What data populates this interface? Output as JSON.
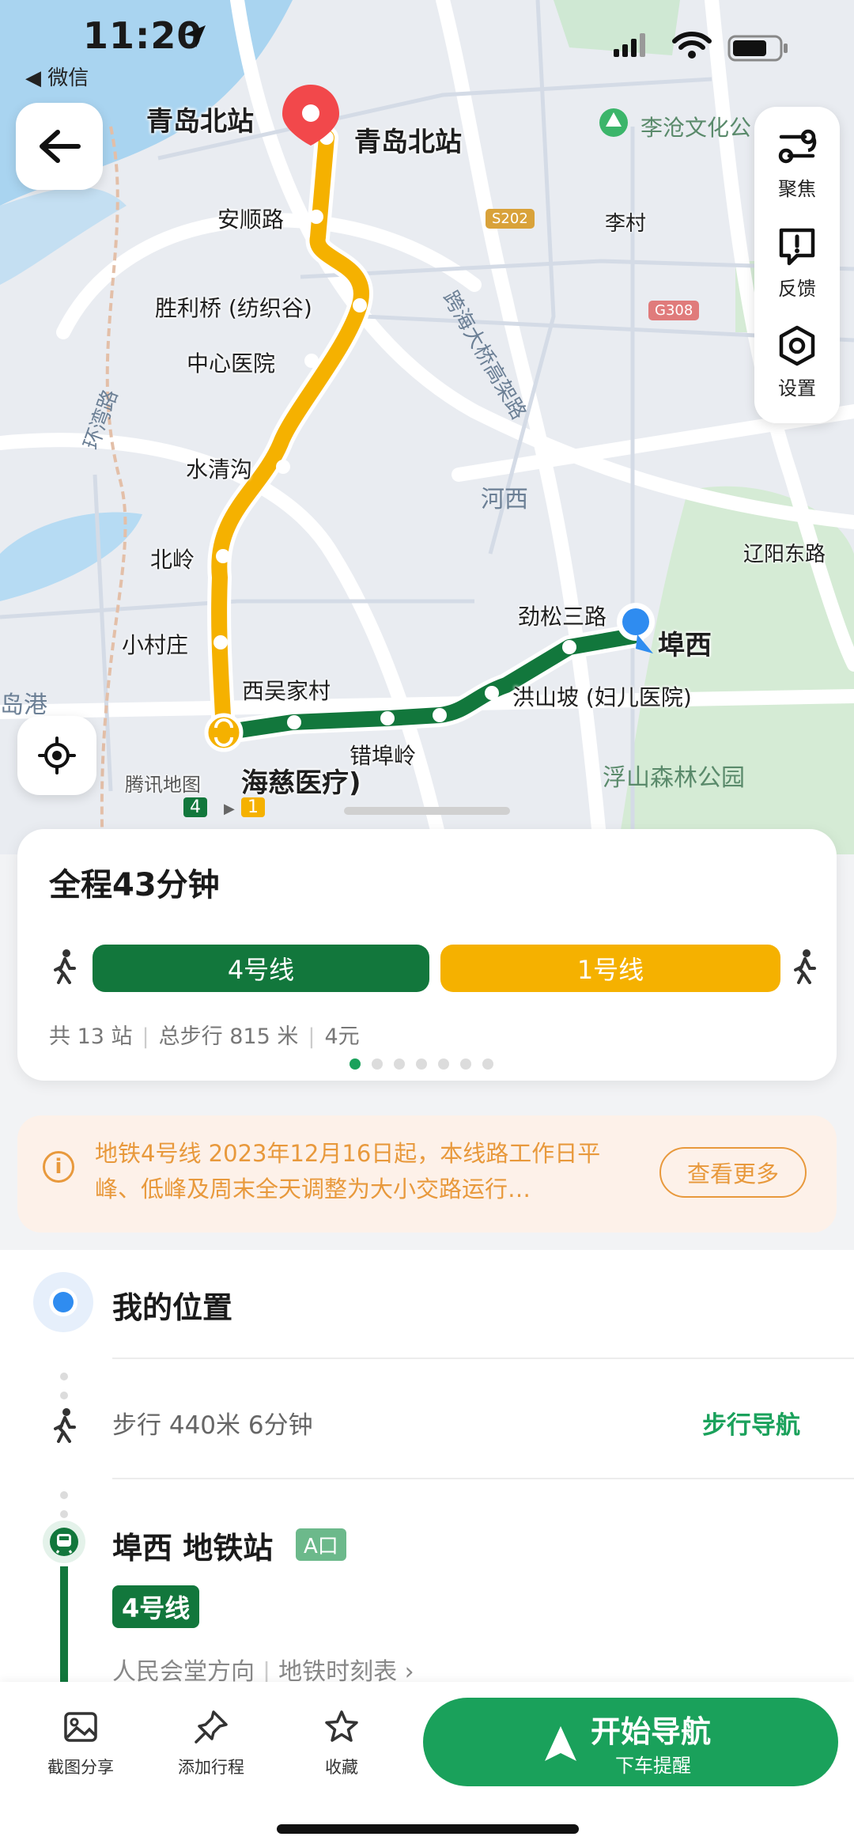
{
  "status_bar": {
    "time": "11:20",
    "back_app": "◀ 微信"
  },
  "map": {
    "tools": [
      {
        "label": "聚焦",
        "icon": "focus-icon"
      },
      {
        "label": "反馈",
        "icon": "feedback-icon"
      },
      {
        "label": "设置",
        "icon": "settings-icon"
      }
    ],
    "destination_label": "青岛北站",
    "station_labels": {
      "qingdao_north": "青岛北站",
      "anshun": "安顺路",
      "shengliqiao": "胜利桥 (纺织谷)",
      "zhongxin": "中心医院",
      "shuiqinggou": "水清沟",
      "beiling": "北岭",
      "xiaocunzhuang": "小村庄",
      "xiwujiacun": "西吴家村",
      "cuofuling": "错埠岭",
      "hongshanpo": "洪山坡 (妇儿医院)",
      "jinsong": "劲松三路",
      "fuxi": "埠西",
      "haici": "海慈医疗)"
    },
    "area_labels": {
      "licun": "李村",
      "hexi": "河西",
      "liaoyang": "辽阳东路",
      "park": "浮山森林公园",
      "licang_park": "李沧文化公",
      "bridge": "跨海大桥高架路",
      "huanwan": "环湾路",
      "daogang": "岛港"
    },
    "road_badges": {
      "s202": "S202",
      "g308": "G308"
    },
    "transfer_lines": [
      "4",
      "1"
    ],
    "watermark": "腾讯地图",
    "colors": {
      "line1": "#f5b100",
      "line4": "#12773c",
      "accent": "#1aa15b"
    }
  },
  "summary": {
    "title": "全程43分钟",
    "lines": [
      {
        "label": "4号线",
        "color": "#12773c"
      },
      {
        "label": "1号线",
        "color": "#f5b100"
      }
    ],
    "stations": "共 13 站",
    "walk": "总步行 815 米",
    "price": "4元",
    "page_count": 7,
    "page_index": 0
  },
  "notice": {
    "text": "地铁4号线 2023年12月16日起，本线路工作日平峰、低峰及周末全天调整为大小交路运行…",
    "more_label": "查看更多"
  },
  "steps": {
    "origin": "我的位置",
    "walk_text": "步行 440米 6分钟",
    "walk_nav": "步行导航",
    "station_name": "埠西 地铁站",
    "exit": "A口",
    "line_tag": "4号线",
    "direction": "人民会堂方向",
    "timetable": "地铁时刻表 ›"
  },
  "bottom_bar": {
    "items": [
      {
        "label": "截图分享",
        "icon": "screenshot-share-icon"
      },
      {
        "label": "添加行程",
        "icon": "add-trip-icon"
      },
      {
        "label": "收藏",
        "icon": "star-icon"
      }
    ],
    "nav_main": "开始导航",
    "nav_sub": "下车提醒"
  }
}
